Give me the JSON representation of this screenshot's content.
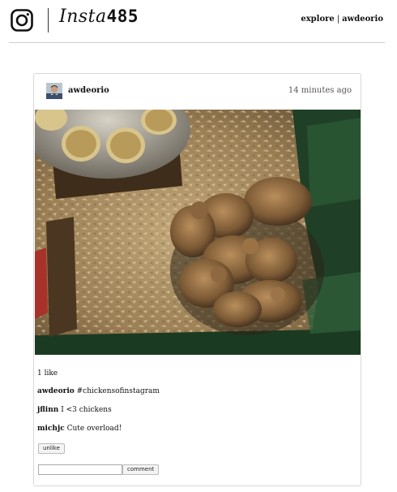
{
  "header": {
    "brand_script": "Insta",
    "brand_number": "485",
    "nav_explore": "explore",
    "nav_separator": "|",
    "nav_user": "awdeorio"
  },
  "post": {
    "owner": "awdeorio",
    "timestamp": "14 minutes ago",
    "likes_text": "1 like",
    "comments": [
      {
        "owner": "awdeorio",
        "text": "#chickensofinstagram"
      },
      {
        "owner": "jflinn",
        "text": "I <3 chickens"
      },
      {
        "owner": "michjc",
        "text": "Cute overload!"
      }
    ],
    "unlike_label": "unlike",
    "comment_button_label": "comment",
    "comment_input_value": ""
  },
  "icons": {
    "logo": "instagram-camera-icon"
  }
}
